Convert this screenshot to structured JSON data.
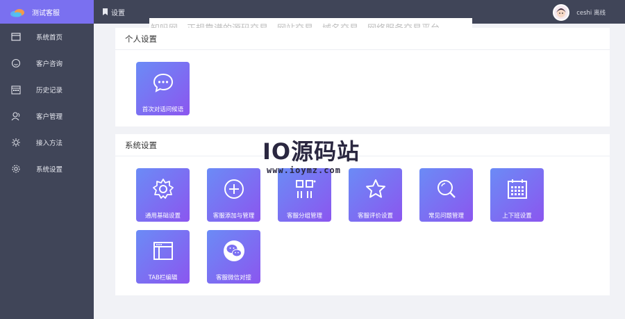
{
  "brand": {
    "title": "测试客服"
  },
  "sidebar": {
    "items": [
      {
        "label": "系统首页",
        "icon": "window-icon"
      },
      {
        "label": "客户咨询",
        "icon": "smile-icon"
      },
      {
        "label": "历史记录",
        "icon": "calendar-icon"
      },
      {
        "label": "客户管理",
        "icon": "users-icon"
      },
      {
        "label": "接入方法",
        "icon": "gear-spark-icon"
      },
      {
        "label": "系统设置",
        "icon": "gear-icon"
      }
    ]
  },
  "topbar": {
    "breadcrumb": "设置",
    "user_name": "ceshi 离线"
  },
  "banner": {
    "text": "知吗网，正规靠谱的源码交易、网站交易，域名交易，网络服务交易平台"
  },
  "personal": {
    "title": "个人设置",
    "tiles": [
      {
        "label": "首次对话问候语",
        "icon": "chat-bubble-icon"
      }
    ]
  },
  "system": {
    "title": "系统设置",
    "tiles": [
      {
        "label": "通用基础设置",
        "icon": "gear-icon"
      },
      {
        "label": "客服添加与管理",
        "icon": "plus-circle-icon"
      },
      {
        "label": "客服分组管理",
        "icon": "group-icon"
      },
      {
        "label": "客服评价设置",
        "icon": "star-icon"
      },
      {
        "label": "常见问题管理",
        "icon": "search-icon"
      },
      {
        "label": "上下班设置",
        "icon": "calendar-icon"
      },
      {
        "label": "TAB栏编辑",
        "icon": "browser-window-icon"
      },
      {
        "label": "客服微信对接",
        "icon": "wechat-icon"
      }
    ]
  },
  "watermark": {
    "title": "IO源码站",
    "url": "www.ioymz.com"
  },
  "colors": {
    "sidebar": "#404558",
    "brand": "#7a70f0",
    "tile_start": "#6b8bf6",
    "tile_end": "#8b56ef"
  }
}
